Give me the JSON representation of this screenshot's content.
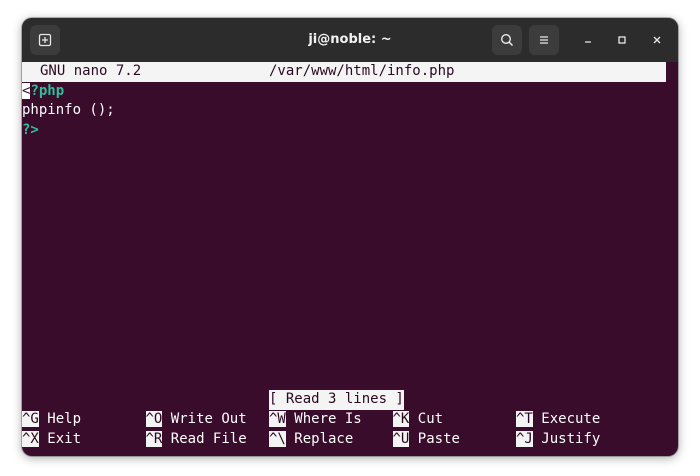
{
  "window": {
    "title": "ji@noble: ~",
    "buttons": {
      "new_tab_icon": "new-tab-icon",
      "search_icon": "search-icon",
      "menu_icon": "hamburger-menu-icon",
      "minimize": "–",
      "maximize": "□",
      "close": "×"
    }
  },
  "nano": {
    "version_label": "GNU nano 7.2",
    "file_path": "/var/www/html/info.php",
    "lines": {
      "line1_cursor": "<",
      "line1_rest": "?php",
      "line2": "phpinfo ();",
      "line3": "?>"
    },
    "status": "[ Read 3 lines ]",
    "shortcuts": [
      {
        "key": "^G",
        "label": " Help"
      },
      {
        "key": "^O",
        "label": " Write Out"
      },
      {
        "key": "^W",
        "label": " Where Is"
      },
      {
        "key": "^K",
        "label": " Cut"
      },
      {
        "key": "^T",
        "label": " Execute"
      },
      {
        "key": "^X",
        "label": " Exit"
      },
      {
        "key": "^R",
        "label": " Read File"
      },
      {
        "key": "^\\",
        "label": " Replace"
      },
      {
        "key": "^U",
        "label": " Paste"
      },
      {
        "key": "^J",
        "label": " Justify"
      }
    ]
  },
  "colors": {
    "terminal_bg": "#380c2a",
    "titlebar_bg": "#2c2c2c",
    "keyword": "#2fbf9c",
    "header_bg": "#f4f4f4"
  }
}
